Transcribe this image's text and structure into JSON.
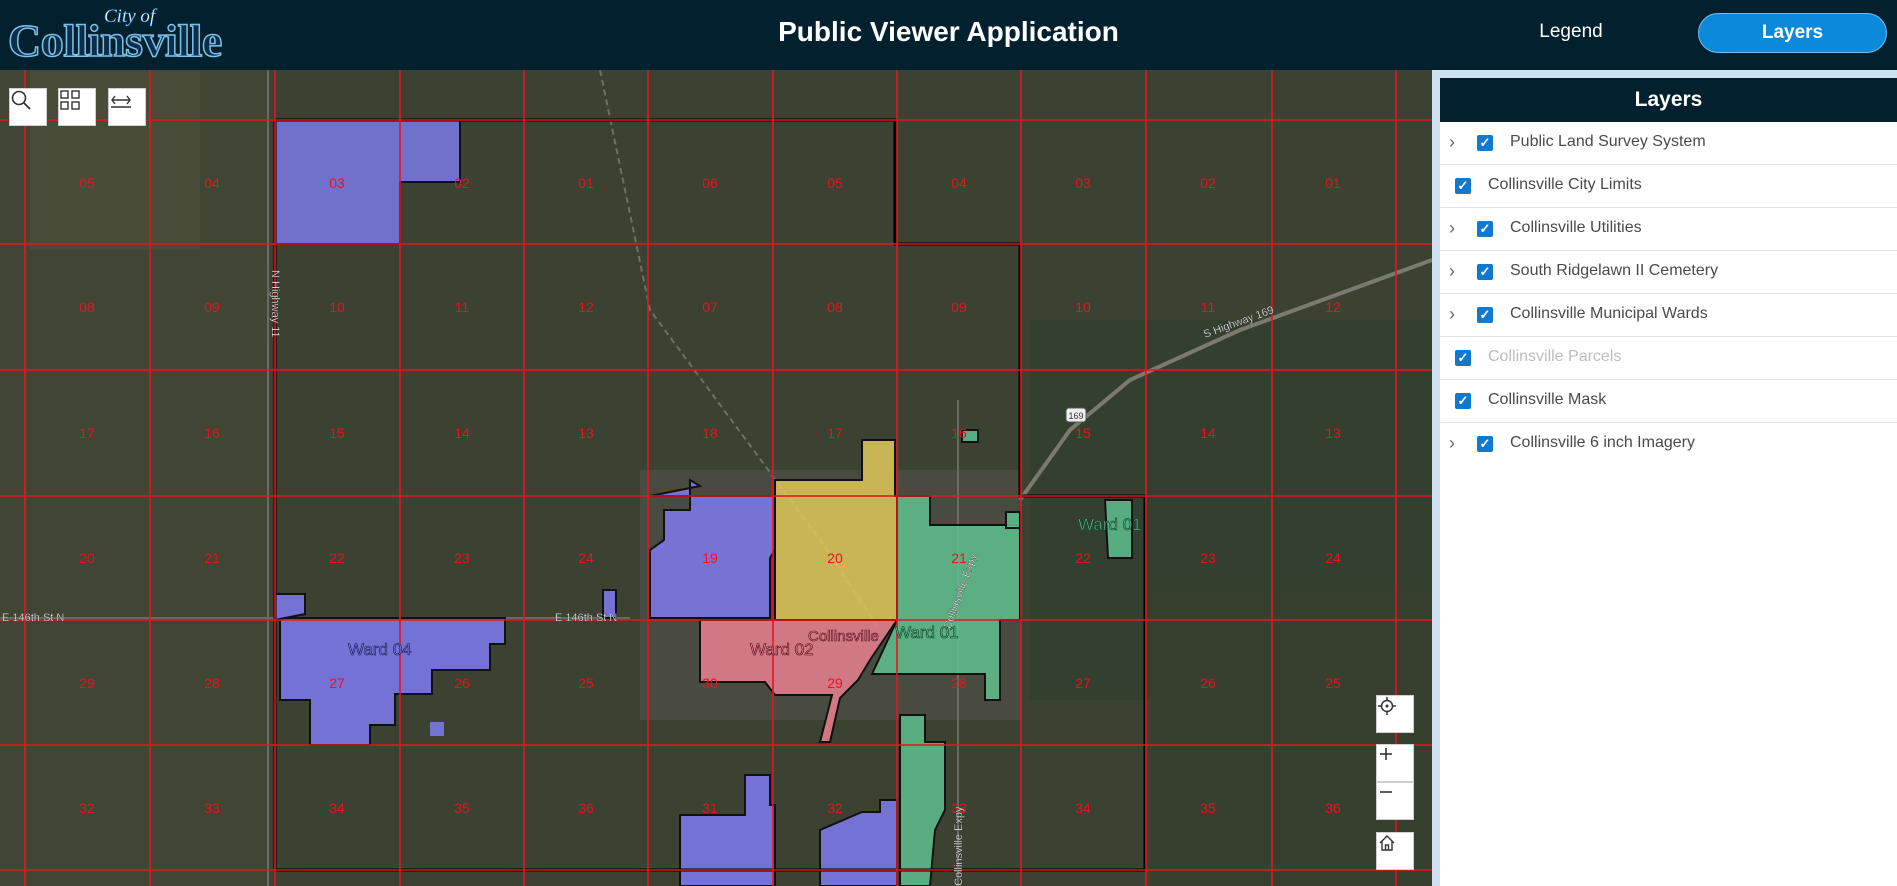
{
  "header": {
    "logo_small": "City of",
    "logo_big": "Collinsville",
    "title": "Public Viewer Application",
    "legend_label": "Legend",
    "layers_label": "Layers"
  },
  "map": {
    "sections_row1": [
      "05",
      "04",
      "03",
      "02",
      "01",
      "06",
      "05",
      "04",
      "03",
      "02",
      "01"
    ],
    "sections_row2": [
      "08",
      "09",
      "10",
      "11",
      "12",
      "07",
      "08",
      "09",
      "10",
      "11",
      "12"
    ],
    "sections_row3": [
      "17",
      "16",
      "15",
      "14",
      "13",
      "18",
      "17",
      "16",
      "15",
      "14",
      "13"
    ],
    "sections_row4": [
      "20",
      "21",
      "22",
      "23",
      "24",
      "19",
      "20",
      "21",
      "22",
      "23",
      "24"
    ],
    "sections_row5": [
      "29",
      "28",
      "27",
      "26",
      "25",
      "30",
      "29",
      "28",
      "27",
      "26",
      "25"
    ],
    "sections_row6": [
      "32",
      "33",
      "34",
      "35",
      "36",
      "31",
      "32",
      "33",
      "34",
      "35",
      "36"
    ],
    "ward_labels": [
      "Ward 01",
      "Ward 01",
      "Ward 02",
      "Ward 04"
    ],
    "city_label": "Collinsville",
    "road_labels": [
      "S Highway 169",
      "E 146th St N",
      "E 146th St N",
      "N Highway 11",
      "Collinsville Expy",
      "Collinsville Expy"
    ],
    "shield_label": "169",
    "colors": {
      "ward01": "#5fbf8f",
      "ward02": "#e8808f",
      "ward03": "#e0c85a",
      "ward04": "#7b78e6",
      "grid": "#e8141e",
      "boundary": "#000000"
    }
  },
  "panel": {
    "title": "Layers",
    "layers": [
      {
        "label": "Public Land Survey System",
        "expandable": true,
        "checked": true,
        "dim": false
      },
      {
        "label": "Collinsville City Limits",
        "expandable": false,
        "checked": true,
        "dim": false
      },
      {
        "label": "Collinsville Utilities",
        "expandable": true,
        "checked": true,
        "dim": false
      },
      {
        "label": "South Ridgelawn II Cemetery",
        "expandable": true,
        "checked": true,
        "dim": false
      },
      {
        "label": "Collinsville Municipal Wards",
        "expandable": true,
        "checked": true,
        "dim": false
      },
      {
        "label": "Collinsville Parcels",
        "expandable": false,
        "checked": true,
        "dim": true
      },
      {
        "label": "Collinsville Mask",
        "expandable": false,
        "checked": true,
        "dim": false
      },
      {
        "label": "Collinsville 6 inch Imagery",
        "expandable": true,
        "checked": true,
        "dim": false
      }
    ]
  }
}
